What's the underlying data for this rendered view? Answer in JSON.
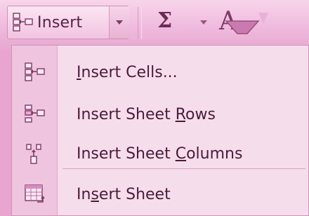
{
  "toolbar": {
    "insert_label": "Insert",
    "sigma_glyph": "Σ"
  },
  "menu": {
    "items": [
      {
        "label": "Insert Cells...",
        "before": "",
        "key": "I",
        "after": "nsert Cells...",
        "icon": "insert-cells-icon"
      },
      {
        "label": "Insert Sheet Rows",
        "before": "Insert Sheet ",
        "key": "R",
        "after": "ows",
        "icon": "insert-rows-icon"
      },
      {
        "label": "Insert Sheet Columns",
        "before": "Insert Sheet ",
        "key": "C",
        "after": "olumns",
        "icon": "insert-columns-icon"
      },
      {
        "label": "Insert Sheet",
        "before": "In",
        "key": "s",
        "after": "ert Sheet",
        "icon": "insert-sheet-icon"
      }
    ]
  },
  "colors": {
    "background": "#e9a5cf",
    "menu_background": "#f6ddec",
    "text": "#4a1b3a"
  }
}
